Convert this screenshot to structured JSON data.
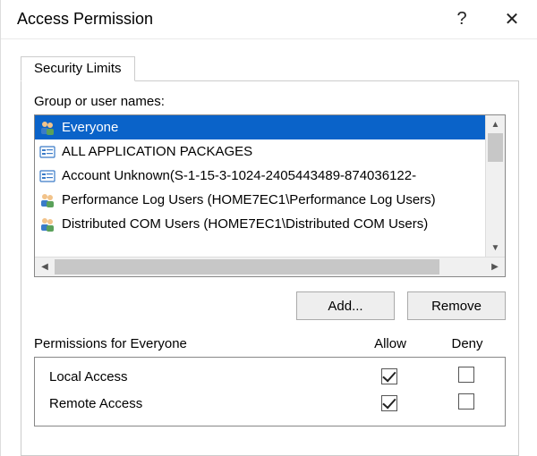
{
  "titlebar": {
    "title": "Access Permission",
    "help_label": "?",
    "close_label": "✕"
  },
  "tab": {
    "label": "Security Limits"
  },
  "group_label": "Group or user names:",
  "users": [
    {
      "name": "Everyone",
      "icon": "group-icon",
      "selected": true
    },
    {
      "name": "ALL APPLICATION PACKAGES",
      "icon": "package-icon",
      "selected": false
    },
    {
      "name": "Account Unknown(S-1-15-3-1024-2405443489-874036122-",
      "icon": "package-icon",
      "selected": false
    },
    {
      "name": "Performance Log Users (HOME7EC1\\Performance Log Users)",
      "icon": "group-icon",
      "selected": false
    },
    {
      "name": "Distributed COM Users (HOME7EC1\\Distributed COM Users)",
      "icon": "group-icon",
      "selected": false
    }
  ],
  "buttons": {
    "add": "Add...",
    "remove": "Remove"
  },
  "permissions": {
    "header_for": "Permissions for Everyone",
    "col_allow": "Allow",
    "col_deny": "Deny",
    "rows": [
      {
        "label": "Local Access",
        "allow": true,
        "deny": false
      },
      {
        "label": "Remote Access",
        "allow": true,
        "deny": false
      }
    ]
  }
}
